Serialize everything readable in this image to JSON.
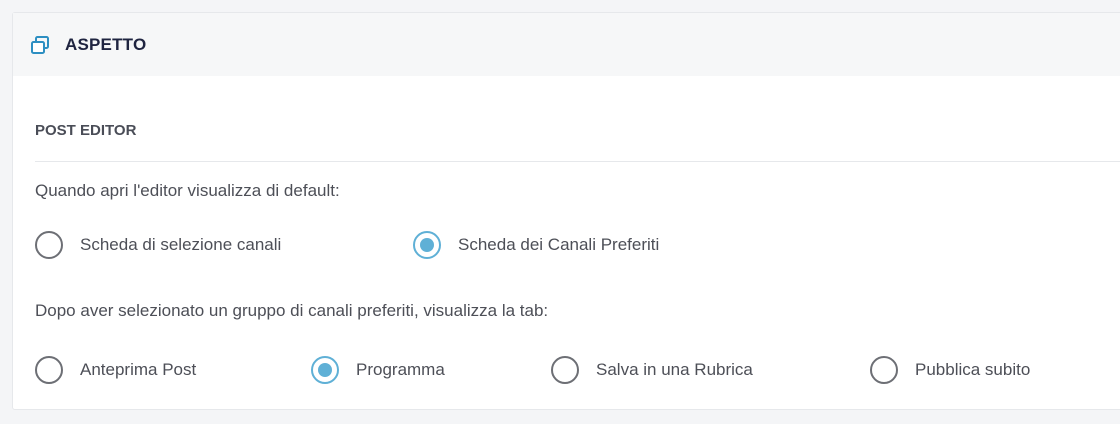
{
  "header": {
    "title": "ASPETTO",
    "icon": "windows-icon",
    "icon_color": "#2d8fc2"
  },
  "section": {
    "title": "POST EDITOR"
  },
  "editor_default": {
    "question": "Quando apri l'editor visualizza di default:",
    "options": [
      {
        "label": "Scheda di selezione canali",
        "checked": false
      },
      {
        "label": "Scheda dei Canali Preferiti",
        "checked": true
      }
    ]
  },
  "favorite_tab": {
    "question": "Dopo aver selezionato un gruppo di canali preferiti, visualizza la tab:",
    "options": [
      {
        "label": "Anteprima Post",
        "checked": false
      },
      {
        "label": "Programma",
        "checked": true
      },
      {
        "label": "Salva in una Rubrica",
        "checked": false
      },
      {
        "label": "Pubblica subito",
        "checked": false
      }
    ]
  },
  "colors": {
    "accent": "#5fb0d6",
    "title": "#1f2440",
    "text": "#4d4f57"
  }
}
